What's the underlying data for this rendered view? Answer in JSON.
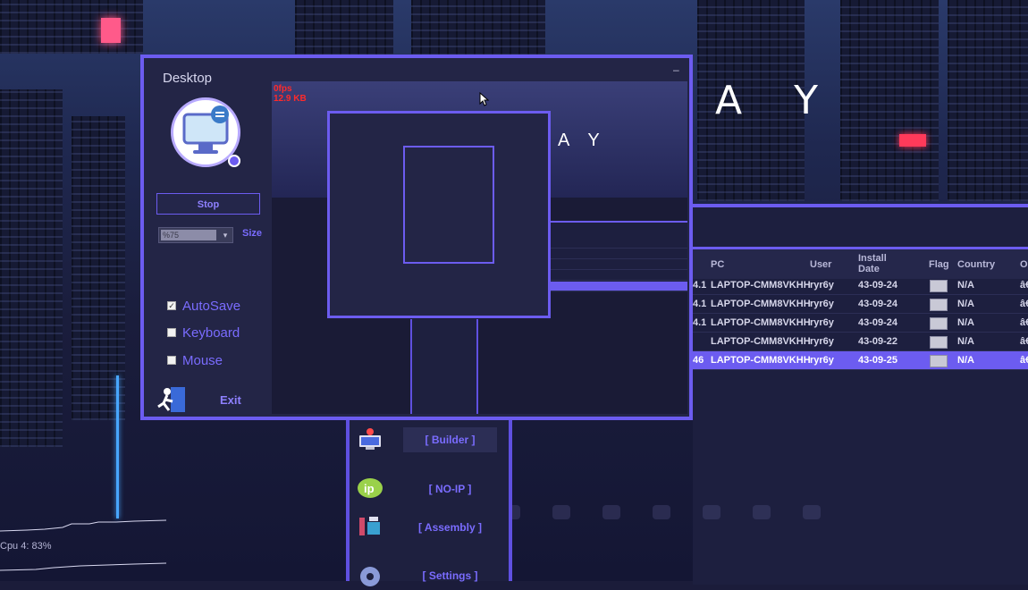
{
  "background_title": "A Y",
  "desktop_window": {
    "title": "Desktop",
    "minimize_glyph": "–",
    "stop_label": "Stop",
    "size_value": "%75",
    "size_label": "Size",
    "options": [
      {
        "label": "AutoSave",
        "checked": true
      },
      {
        "label": "Keyboard",
        "checked": false
      },
      {
        "label": "Mouse",
        "checked": false
      }
    ],
    "exit_label": "Exit",
    "preview": {
      "fps": "0fps",
      "data_rate": "12.9 KB",
      "ay_text": "A Y"
    }
  },
  "clients_table": {
    "columns": [
      "PC",
      "User",
      "Install Date",
      "Flag",
      "Country",
      "O"
    ],
    "rows": [
      {
        "id": "4.1",
        "pc": "LAPTOP-CMM8VKHH",
        "user": "ryr6y",
        "install_date": "43-09-24",
        "country": "N/A",
        "os": "â€",
        "selected": false
      },
      {
        "id": "4.1",
        "pc": "LAPTOP-CMM8VKHH",
        "user": "ryr6y",
        "install_date": "43-09-24",
        "country": "N/A",
        "os": "â€",
        "selected": false
      },
      {
        "id": "4.1",
        "pc": "LAPTOP-CMM8VKHH",
        "user": "ryr6y",
        "install_date": "43-09-24",
        "country": "N/A",
        "os": "â€",
        "selected": false
      },
      {
        "id": "",
        "pc": "LAPTOP-CMM8VKHH",
        "user": "ryr6y",
        "install_date": "43-09-22",
        "country": "N/A",
        "os": "â€",
        "selected": false
      },
      {
        "id": "46",
        "pc": "LAPTOP-CMM8VKHH",
        "user": "ryr6y",
        "install_date": "43-09-25",
        "country": "N/A",
        "os": "â€",
        "selected": true
      }
    ]
  },
  "side_menu": {
    "items": [
      {
        "label": "[ Builder ]",
        "icon": "computer-pin-icon",
        "active": true
      },
      {
        "label": "[ NO-IP ]",
        "icon": "noip-logo-icon",
        "active": false
      },
      {
        "label": "[ Assembly ]",
        "icon": "assembly-icon",
        "active": false
      },
      {
        "label": "[ Settings ]",
        "icon": "gear-icon",
        "active": false
      }
    ]
  },
  "cpu_readout": "Cpu 4:  83%",
  "colors": {
    "accent": "#6c5cf0",
    "panel": "#232546",
    "label": "#7a6cff",
    "fps_red": "#ff2a2a"
  }
}
